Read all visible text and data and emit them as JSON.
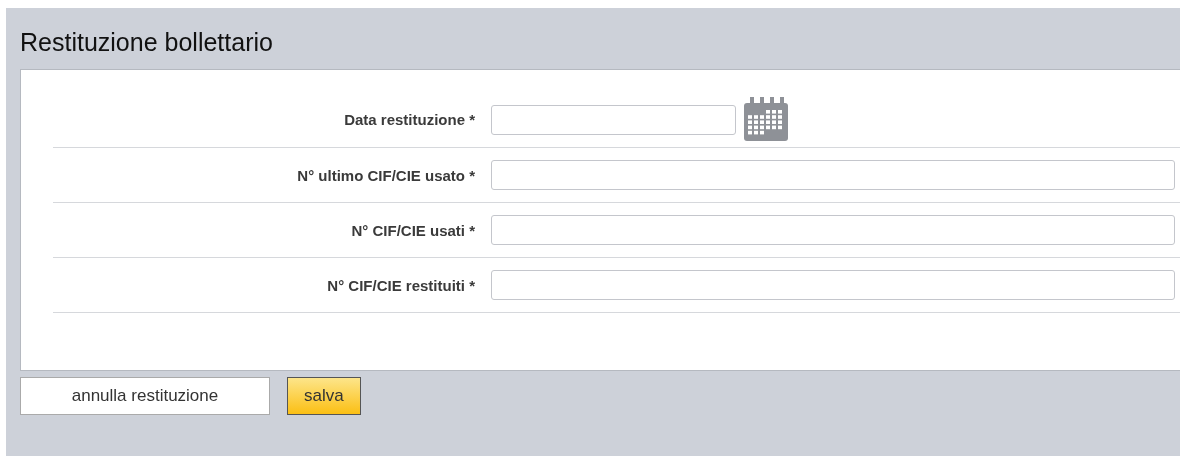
{
  "title": "Restituzione bollettario",
  "fields": [
    {
      "label": "Data restituzione *",
      "kind": "date"
    },
    {
      "label": "N° ultimo CIF/CIE usato *",
      "kind": "text"
    },
    {
      "label": "N° CIF/CIE usati *",
      "kind": "text"
    },
    {
      "label": "N° CIF/CIE restituiti *",
      "kind": "text"
    }
  ],
  "buttons": [
    {
      "label": "annulla restituzione",
      "kind": "secondary"
    },
    {
      "label": "salva",
      "kind": "primary"
    }
  ]
}
